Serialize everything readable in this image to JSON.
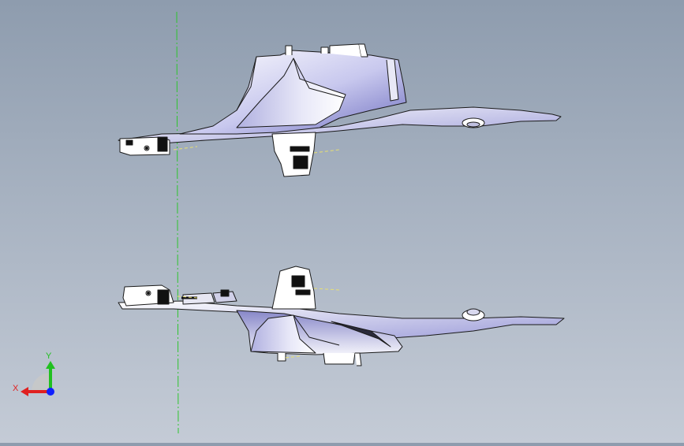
{
  "viewport": {
    "background_top": "#8e9cae",
    "background_bottom": "#c4cbd6",
    "centerline_color": "#2ec52e",
    "hidden_edge_color": "#e8e070",
    "part_fill": "#ffffff",
    "part_shade": "#8a8ad0",
    "part_edge": "#1a1a1a"
  },
  "parts": [
    {
      "name": "part-top-view",
      "description_visible": false
    },
    {
      "name": "part-bottom-view",
      "description_visible": false
    }
  ],
  "triad": {
    "x_label": "X",
    "y_label": "Y",
    "x_color": "#e02020",
    "y_color": "#20c020",
    "z_color": "#2030e0",
    "origin_color": "#1020ff"
  }
}
